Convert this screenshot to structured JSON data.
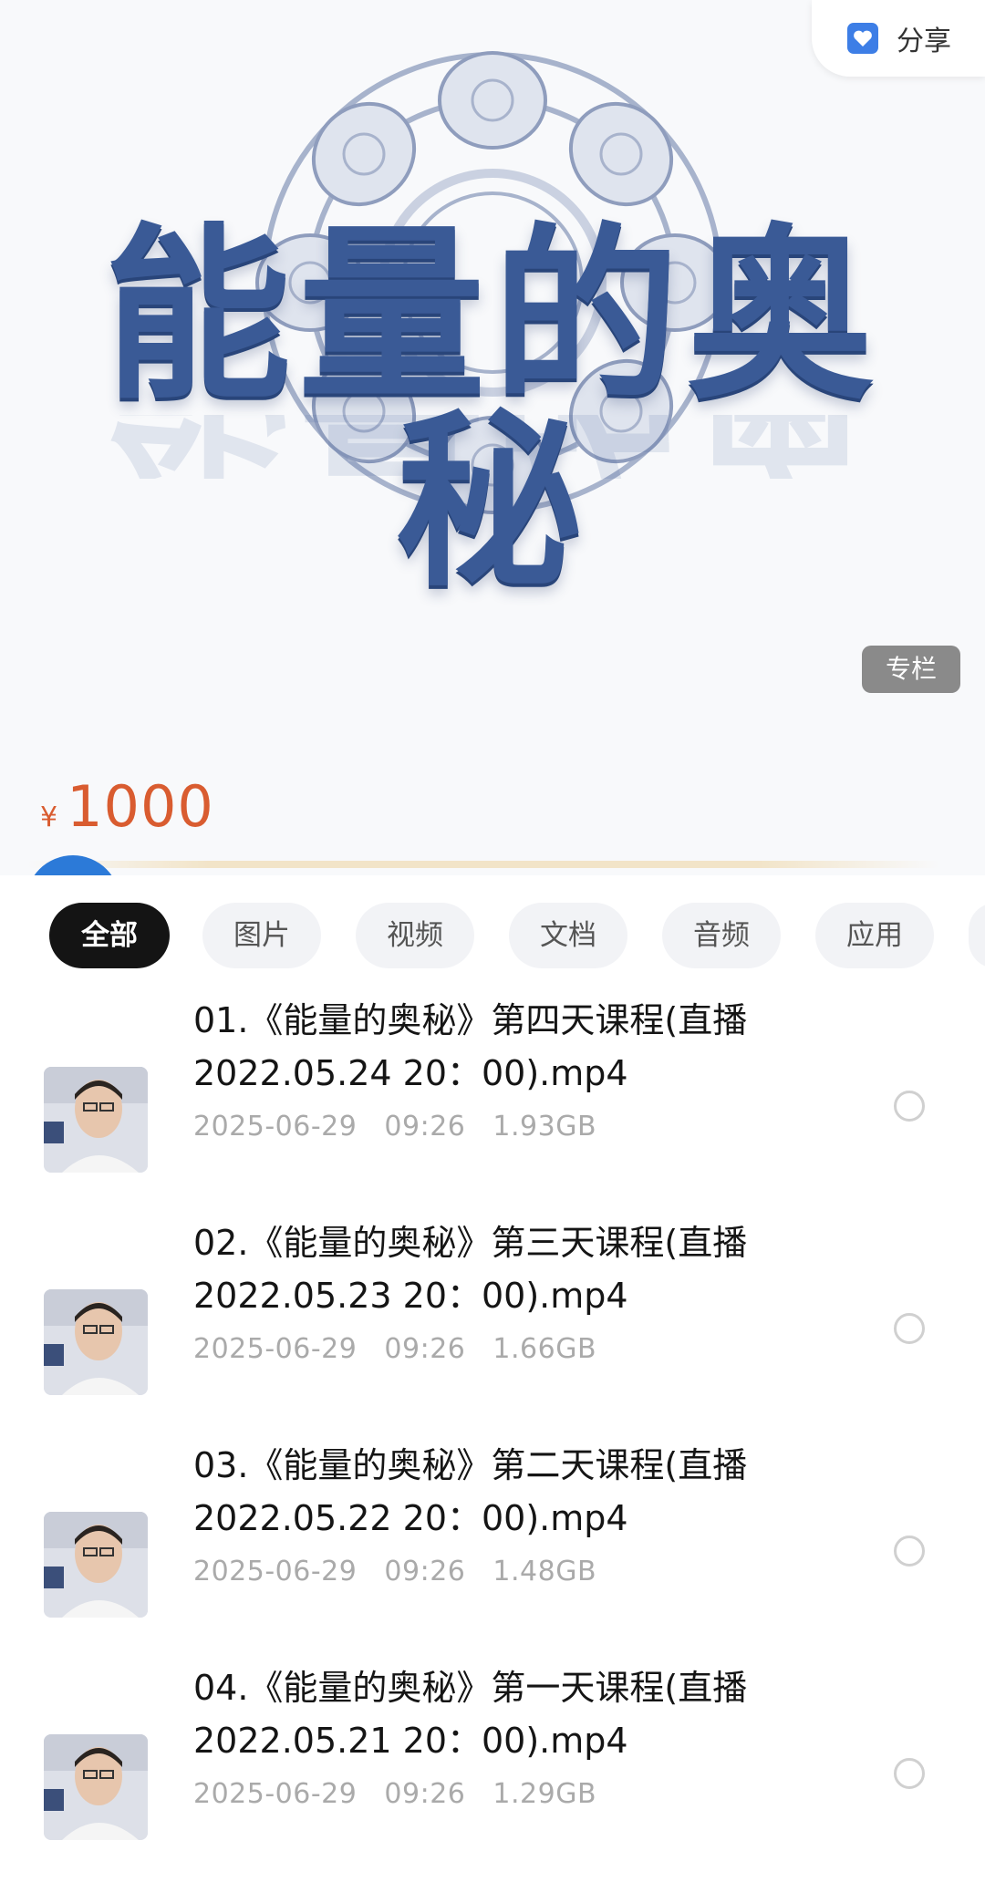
{
  "header": {
    "share_label": "分享",
    "banner_title": "能量的奥秘",
    "tag": "专栏",
    "currency": "¥",
    "price": "1000"
  },
  "filters": [
    {
      "label": "全部",
      "active": true
    },
    {
      "label": "图片",
      "active": false
    },
    {
      "label": "视频",
      "active": false
    },
    {
      "label": "文档",
      "active": false
    },
    {
      "label": "音频",
      "active": false
    },
    {
      "label": "应用",
      "active": false
    }
  ],
  "files": [
    {
      "name_line1": "01.《能量的奥秘》第四天课程(直播",
      "name_line2": "2022.05.24 20：00).mp4",
      "date": "2025-06-29",
      "time": "09:26",
      "size": "1.93GB"
    },
    {
      "name_line1": "02.《能量的奥秘》第三天课程(直播",
      "name_line2": "2022.05.23 20：00).mp4",
      "date": "2025-06-29",
      "time": "09:26",
      "size": "1.66GB"
    },
    {
      "name_line1": "03.《能量的奥秘》第二天课程(直播",
      "name_line2": "2022.05.22 20：00).mp4",
      "date": "2025-06-29",
      "time": "09:26",
      "size": "1.48GB"
    },
    {
      "name_line1": "04.《能量的奥秘》第一天课程(直播",
      "name_line2": "2022.05.21 20：00).mp4",
      "date": "2025-06-29",
      "time": "09:26",
      "size": "1.29GB"
    }
  ],
  "colors": {
    "accent_price": "#d95c30",
    "title_blue": "#3a5a96",
    "active_chip": "#141414"
  }
}
